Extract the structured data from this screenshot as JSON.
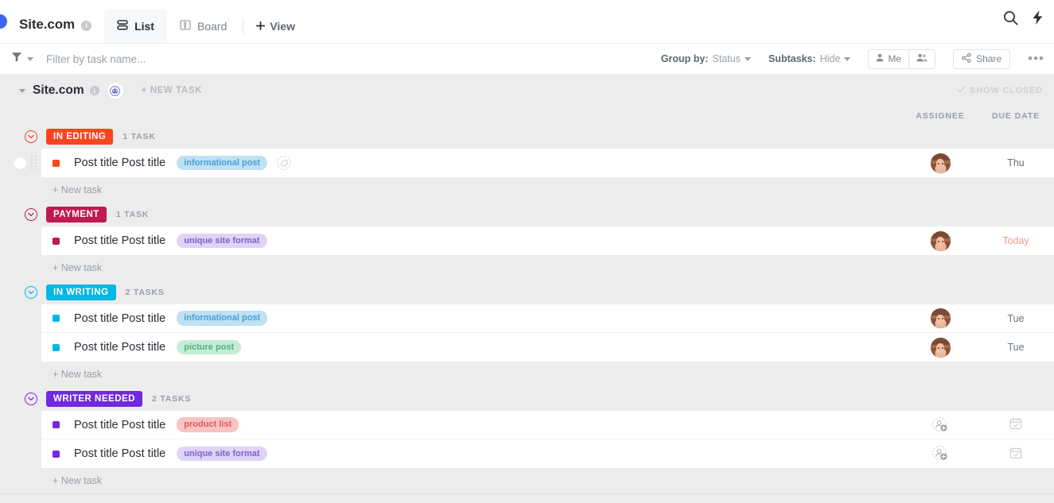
{
  "topbar": {
    "app_title": "Site.com",
    "info_icon": "info-icon",
    "tabs": [
      {
        "label": "List",
        "icon": "list-icon",
        "active": true
      },
      {
        "label": "Board",
        "icon": "board-icon",
        "active": false
      }
    ],
    "add_view_label": "View",
    "search_icon": "search-icon",
    "lightning_icon": "lightning-bolt-icon"
  },
  "filterbar": {
    "funnel_icon": "funnel-icon",
    "filter_placeholder": "Filter by task name...",
    "filter_value": "",
    "group_by_label": "Group by:",
    "group_by_value": "Status",
    "subtasks_label": "Subtasks:",
    "subtasks_value": "Hide",
    "me_label": "Me",
    "people_icon": "people-icon",
    "share_label": "Share",
    "more_icon": "ellipsis-icon"
  },
  "group": {
    "title": "Site.com",
    "info_icon": "info-icon",
    "automation_icon": "robot-icon",
    "new_task_label": "+ NEW TASK",
    "show_closed_label": "SHOW CLOSED"
  },
  "columns": {
    "assignee": "ASSIGNEE",
    "due_date": "DUE DATE"
  },
  "new_task_label": "+ New task",
  "statuses": [
    {
      "name": "IN EDITING",
      "color": "#f9451d",
      "count_label": "1 TASK",
      "tasks": [
        {
          "title": "Post title Post title",
          "dot_color": "#f9451d",
          "tag": "informational post",
          "tag_bg": "#bfe0f5",
          "tag_fg": "#4a9fd6",
          "has_tag_add": true,
          "assignee": "avatar",
          "due": "Thu",
          "due_today": false
        }
      ]
    },
    {
      "name": "PAYMENT",
      "color": "#bf1a54",
      "count_label": "1 TASK",
      "tasks": [
        {
          "title": "Post title Post title",
          "dot_color": "#bf1a54",
          "tag": "unique site format",
          "tag_bg": "#ddd4f7",
          "tag_fg": "#7d5fc9",
          "has_tag_add": false,
          "assignee": "avatar",
          "due": "Today",
          "due_today": true
        }
      ]
    },
    {
      "name": "IN WRITING",
      "color": "#00b8e6",
      "count_label": "2 TASKS",
      "tasks": [
        {
          "title": "Post title Post title",
          "dot_color": "#00b8e6",
          "tag": "informational post",
          "tag_bg": "#bfe0f5",
          "tag_fg": "#4a9fd6",
          "has_tag_add": false,
          "assignee": "avatar",
          "due": "Tue",
          "due_today": false
        },
        {
          "title": "Post title Post title",
          "dot_color": "#00b8e6",
          "tag": "picture post",
          "tag_bg": "#c5edd5",
          "tag_fg": "#52b07c",
          "has_tag_add": false,
          "assignee": "avatar",
          "due": "Tue",
          "due_today": false
        }
      ]
    },
    {
      "name": "WRITER NEEDED",
      "color": "#7229e0",
      "count_label": "2 TASKS",
      "tasks": [
        {
          "title": "Post title Post title",
          "dot_color": "#7229e0",
          "tag": "product list",
          "tag_bg": "#f9c3c3",
          "tag_fg": "#e05a5a",
          "has_tag_add": false,
          "assignee": "empty",
          "due": "",
          "due_today": false
        },
        {
          "title": "Post title Post title",
          "dot_color": "#7229e0",
          "tag": "unique site format",
          "tag_bg": "#ddd4f7",
          "tag_fg": "#7d5fc9",
          "has_tag_add": false,
          "assignee": "empty",
          "due": "",
          "due_today": false
        }
      ]
    }
  ]
}
